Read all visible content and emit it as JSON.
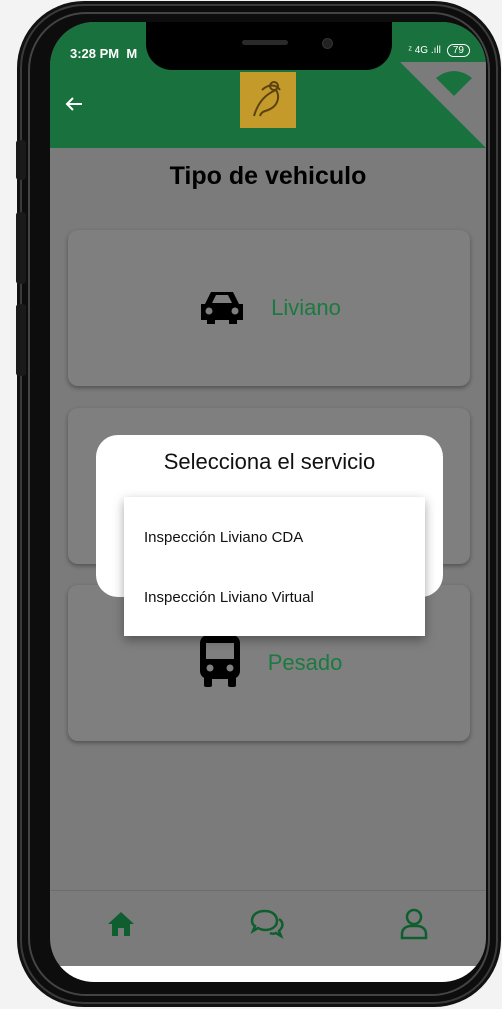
{
  "status_bar": {
    "time": "3:28 PM",
    "signal": "4G",
    "battery": "79"
  },
  "header": {
    "back_icon": "arrow-left-icon",
    "logo": "app-logo",
    "accent_color": "#19713e"
  },
  "page": {
    "title": "Tipo de vehiculo"
  },
  "vehicle_options": [
    {
      "label": "Liviano",
      "icon": "car-icon"
    },
    {
      "label": "Pesado",
      "icon": "bus-icon"
    }
  ],
  "dialog": {
    "title": "Selecciona el servicio",
    "options": [
      "Inspección Liviano CDA",
      "Inspección Liviano Virtual"
    ]
  },
  "bottom_nav": [
    {
      "icon": "home-icon"
    },
    {
      "icon": "chat-icon"
    },
    {
      "icon": "user-icon"
    }
  ]
}
